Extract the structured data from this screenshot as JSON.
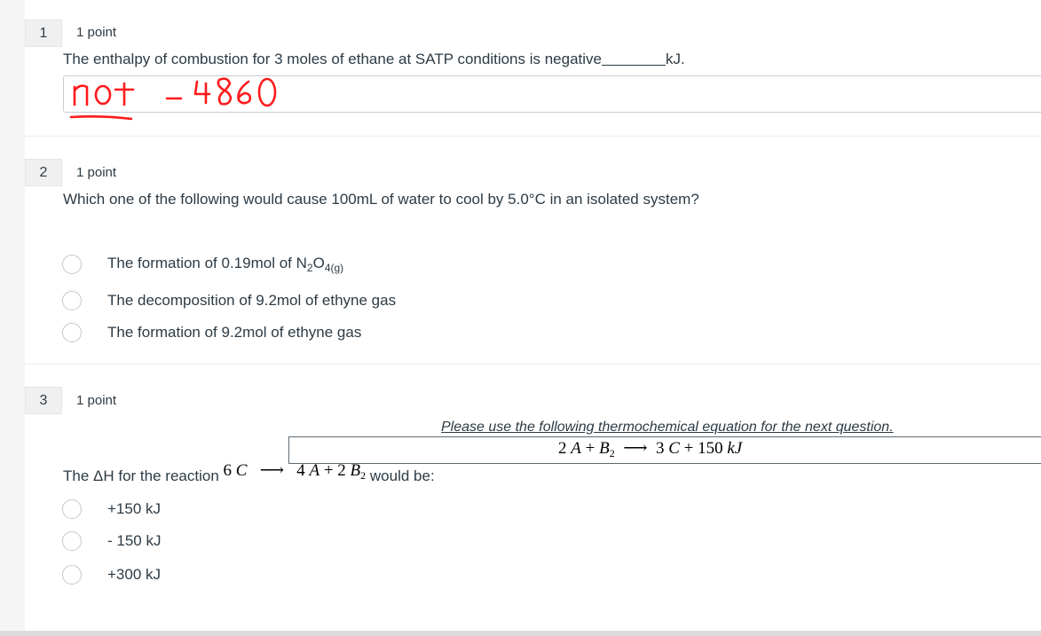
{
  "questions": [
    {
      "number": "1",
      "points": "1 point",
      "text_before": "The enthalpy of combustion for 3 moles of ethane at SATP conditions is negative",
      "text_after": "kJ.",
      "answer_handwriting": "not -4860"
    },
    {
      "number": "2",
      "points": "1 point",
      "text": "Which one of the following would cause 100mL of water to cool by 5.0°C in an isolated system?",
      "options": [
        {
          "label": "The formation of 0.19mol of N",
          "sub1": "2",
          "mid": "O",
          "sub2": "4(g)"
        },
        {
          "label": "The decomposition of 9.2mol of ethyne gas"
        },
        {
          "label": "The formation of 9.2mol of ethyne gas"
        }
      ]
    },
    {
      "number": "3",
      "points": "1 point",
      "equation_title": "Please use the following thermochemical equation for the next question.",
      "equation": {
        "c1": "2",
        "a": "A",
        "plus1": "+",
        "b": "B",
        "bsub": "2",
        "arrow": "⟶",
        "c2": "3",
        "c": "C",
        "plus2": "+",
        "energy": "150",
        "unit": "kJ"
      },
      "text_before": "The ΔH for the reaction",
      "reaction": {
        "c1": "6",
        "c": "C",
        "arrow": "⟶",
        "c2": "4",
        "a": "A",
        "plus": "+",
        "c3": "2",
        "b": "B",
        "bsub": "2"
      },
      "text_after": "would be:",
      "options": [
        {
          "label": "+150 kJ"
        },
        {
          "label": "- 150 kJ"
        },
        {
          "label": "+300 kJ"
        }
      ]
    }
  ]
}
